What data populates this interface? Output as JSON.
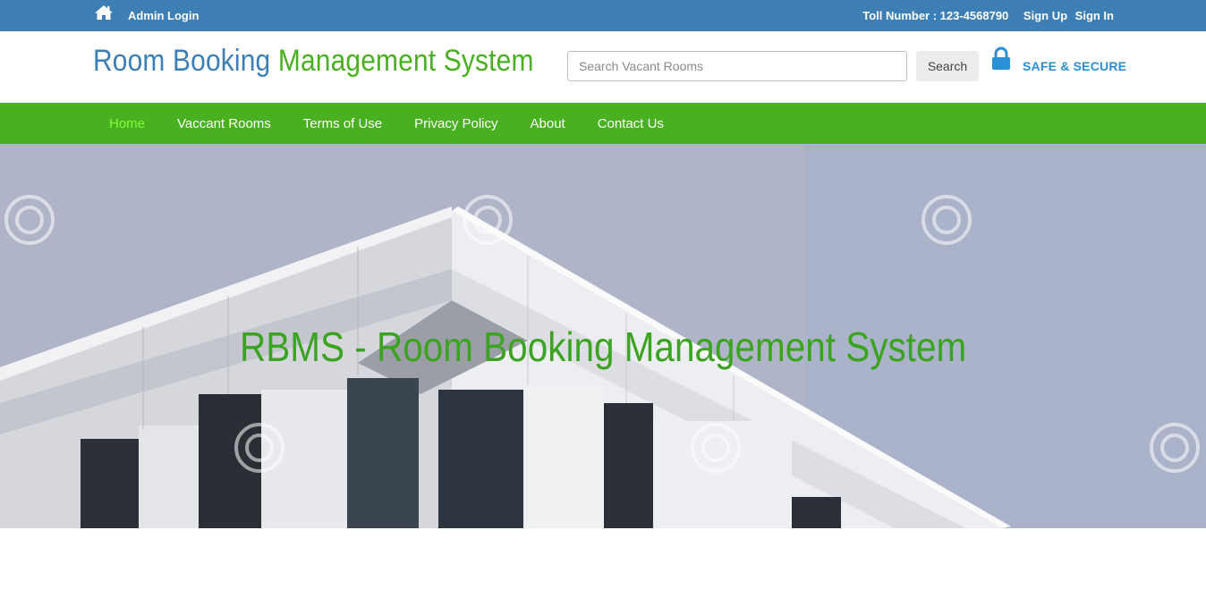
{
  "topbar": {
    "admin_login": "Admin Login",
    "toll_number": "Toll Number : 123-4568790",
    "sign_up": "Sign Up",
    "sign_in": "Sign In"
  },
  "header": {
    "logo_part1": "Room Booking",
    "logo_part2": "Management System",
    "search_placeholder": "Search Vacant Rooms",
    "search_button": "Search",
    "safe_label": "SAFE & SECURE"
  },
  "nav": {
    "items": [
      {
        "label": "Home",
        "active": true
      },
      {
        "label": "Vaccant Rooms",
        "active": false
      },
      {
        "label": "Terms of Use",
        "active": false
      },
      {
        "label": "Privacy Policy",
        "active": false
      },
      {
        "label": "About",
        "active": false
      },
      {
        "label": "Contact Us",
        "active": false
      }
    ]
  },
  "hero": {
    "title": "RBMS - Room Booking Management System",
    "watermark": "dreamstime"
  },
  "colors": {
    "topbar": "#3d7fb4",
    "brand_blue": "#3d7fb4",
    "brand_green": "#49b020",
    "nav_active": "#7dff3a",
    "secure_blue": "#2b8fd6"
  }
}
